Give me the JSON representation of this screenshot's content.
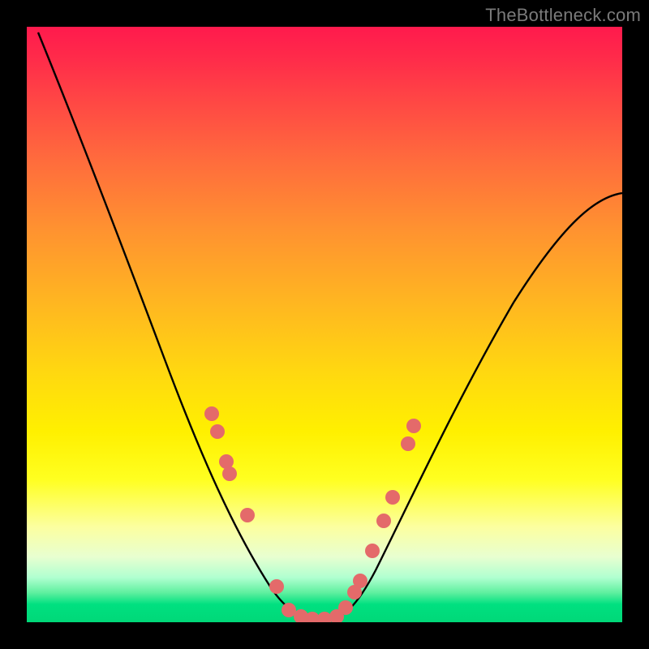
{
  "watermark": "TheBottleneck.com",
  "colors": {
    "frame": "#000000",
    "curve": "#000000",
    "marker": "#e46a6a",
    "gradient_top": "#ff1a4d",
    "gradient_bottom": "#00d878"
  },
  "chart_data": {
    "type": "line",
    "title": "",
    "xlabel": "",
    "ylabel": "",
    "xlim": [
      0,
      100
    ],
    "ylim": [
      0,
      100
    ],
    "grid": false,
    "series": [
      {
        "name": "curve",
        "x": [
          2,
          6,
          10,
          14,
          18,
          22,
          26,
          30,
          33,
          36,
          38,
          40,
          42,
          44,
          46,
          48,
          50,
          53,
          56,
          60,
          64,
          68,
          72,
          76,
          80,
          85,
          90,
          95,
          100
        ],
        "y": [
          99,
          88,
          77,
          68,
          60,
          53,
          46,
          39,
          33,
          27,
          22,
          17,
          12,
          7,
          3,
          1,
          0,
          1,
          5,
          12,
          20,
          28,
          35,
          42,
          48,
          55,
          61,
          67,
          72
        ]
      }
    ],
    "markers": [
      {
        "x": 31,
        "y": 35
      },
      {
        "x": 32,
        "y": 32
      },
      {
        "x": 33.5,
        "y": 27
      },
      {
        "x": 34,
        "y": 25
      },
      {
        "x": 37,
        "y": 18
      },
      {
        "x": 42,
        "y": 6
      },
      {
        "x": 44,
        "y": 2
      },
      {
        "x": 46,
        "y": 1
      },
      {
        "x": 48,
        "y": 0.5
      },
      {
        "x": 50,
        "y": 0.5
      },
      {
        "x": 52,
        "y": 1
      },
      {
        "x": 53.5,
        "y": 2.5
      },
      {
        "x": 55,
        "y": 5
      },
      {
        "x": 56,
        "y": 7
      },
      {
        "x": 58,
        "y": 12
      },
      {
        "x": 60,
        "y": 17
      },
      {
        "x": 61.5,
        "y": 21
      },
      {
        "x": 64,
        "y": 30
      },
      {
        "x": 65,
        "y": 33
      }
    ],
    "annotations": []
  }
}
